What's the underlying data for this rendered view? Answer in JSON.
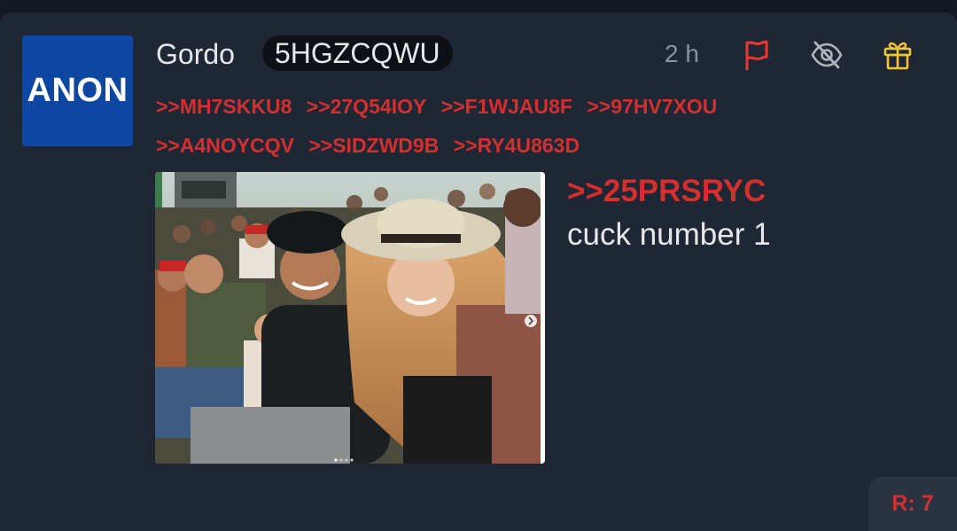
{
  "post": {
    "avatar_text": "ANON",
    "username": "Gordo",
    "post_id": "5HGZCQWU",
    "timestamp": "2 h",
    "reply_links": [
      ">>MH7SKKU8",
      ">>27Q54IOY",
      ">>F1WJAU8F",
      ">>97HV7XOU",
      ">>A4NOYCQV",
      ">>SIDZWD9B",
      ">>RY4U863D"
    ],
    "quote_link": ">>25PRSRYC",
    "message": "cuck number 1",
    "reply_count": "R: 7"
  },
  "icons": {
    "report": "flag-icon",
    "hide": "eye-off-icon",
    "award": "gift-icon"
  },
  "colors": {
    "background": "#141b24",
    "card": "#1e2733",
    "accent_red": "#d32f2f",
    "avatar_blue": "#0d47a1",
    "gift_yellow": "#f4c430",
    "muted": "#8a929c"
  }
}
